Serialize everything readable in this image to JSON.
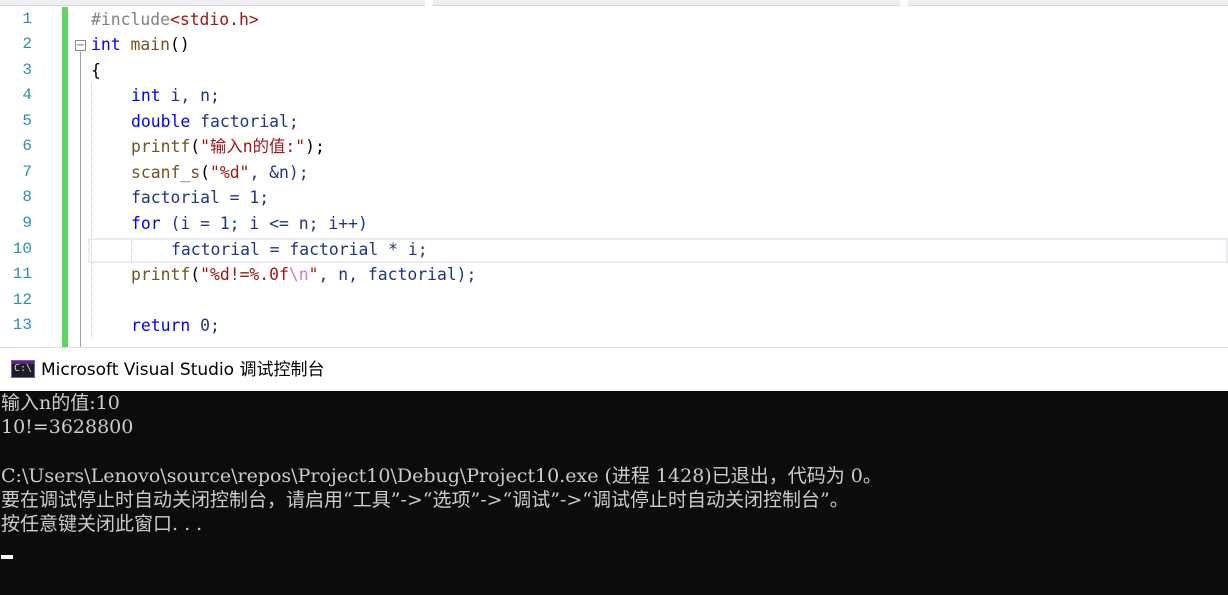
{
  "editor": {
    "line_numbers": [
      "1",
      "2",
      "3",
      "4",
      "5",
      "6",
      "7",
      "8",
      "9",
      "10",
      "11",
      "12",
      "13"
    ],
    "fold_marker": "−",
    "lines": {
      "l1": {
        "pp": "#include",
        "hdr": "<stdio.h>"
      },
      "l2": {
        "kw": "int",
        "name": "main",
        "paren": "()"
      },
      "l3": {
        "brace": "{"
      },
      "l4": {
        "kw": "int",
        "rest": " i, n;"
      },
      "l5": {
        "kw": "double",
        "rest": " factorial;"
      },
      "l6": {
        "fn": "printf",
        "open": "(",
        "str": "\"输入n的值:\"",
        "close": ");"
      },
      "l7": {
        "fn": "scanf_s",
        "open": "(",
        "str": "\"%d\"",
        "rest": ", &n);"
      },
      "l8": {
        "text": "factorial = 1;"
      },
      "l9": {
        "kw": "for",
        "rest": " (i = 1; i <= n; i++)"
      },
      "l10": {
        "text": "factorial = factorial * i;"
      },
      "l11": {
        "fn": "printf",
        "open": "(",
        "str": "\"%d!=%.0f",
        "esc": "\\n",
        "str_end": "\"",
        "rest": ", n, factorial);"
      },
      "l12": {
        "text": ""
      },
      "l13": {
        "kw": "return",
        "rest": " 0;"
      }
    }
  },
  "console": {
    "icon_text": "C:\\",
    "title": "Microsoft Visual Studio 调试控制台",
    "output": [
      "输入n的值:10",
      "10!=3628800",
      "",
      "C:\\Users\\Lenovo\\source\\repos\\Project10\\Debug\\Project10.exe (进程 1428)已退出，代码为 0。",
      "要在调试停止时自动关闭控制台，请启用“工具”->“选项”->“调试”->“调试停止时自动关闭控制台”。",
      "按任意键关闭此窗口. . ."
    ]
  },
  "colors": {
    "keyword": "#0000ff",
    "function": "#74531f",
    "preprocessor": "#808080",
    "string": "#a31515",
    "escape": "#c57ad8",
    "line_number": "#2b91af",
    "change_bar": "#5fd35f",
    "console_bg": "#0c0c0c",
    "console_text": "#cccccc"
  }
}
